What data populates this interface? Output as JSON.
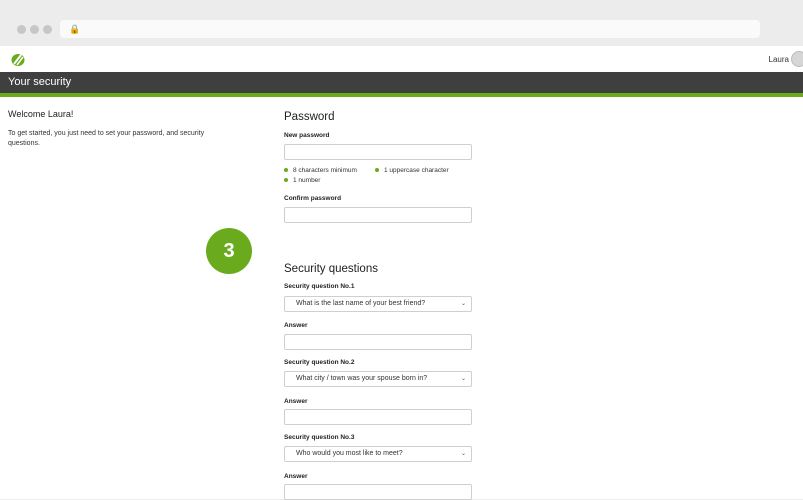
{
  "header": {
    "user_name": "Laura",
    "page_title": "Your security"
  },
  "intro": {
    "welcome": "Welcome Laura!",
    "text": "To get started, you just need to set your password, and security questions."
  },
  "step_badge": "3",
  "password": {
    "heading": "Password",
    "new_label": "New password",
    "requirements": [
      "8 characters minimum",
      "1 uppercase character",
      "1 number"
    ],
    "confirm_label": "Confirm password"
  },
  "security": {
    "heading": "Security questions",
    "questions": [
      {
        "label": "Security question No.1",
        "value": "What is the last name of your best friend?",
        "answer_label": "Answer"
      },
      {
        "label": "Security question No.2",
        "value": "What city / town was your spouse born in?",
        "answer_label": "Answer"
      },
      {
        "label": "Security question No.3",
        "value": "Who would you most like to meet?",
        "answer_label": "Answer"
      }
    ]
  },
  "colors": {
    "accent_green": "#6aab1e",
    "title_bar": "#3f3f3f"
  }
}
